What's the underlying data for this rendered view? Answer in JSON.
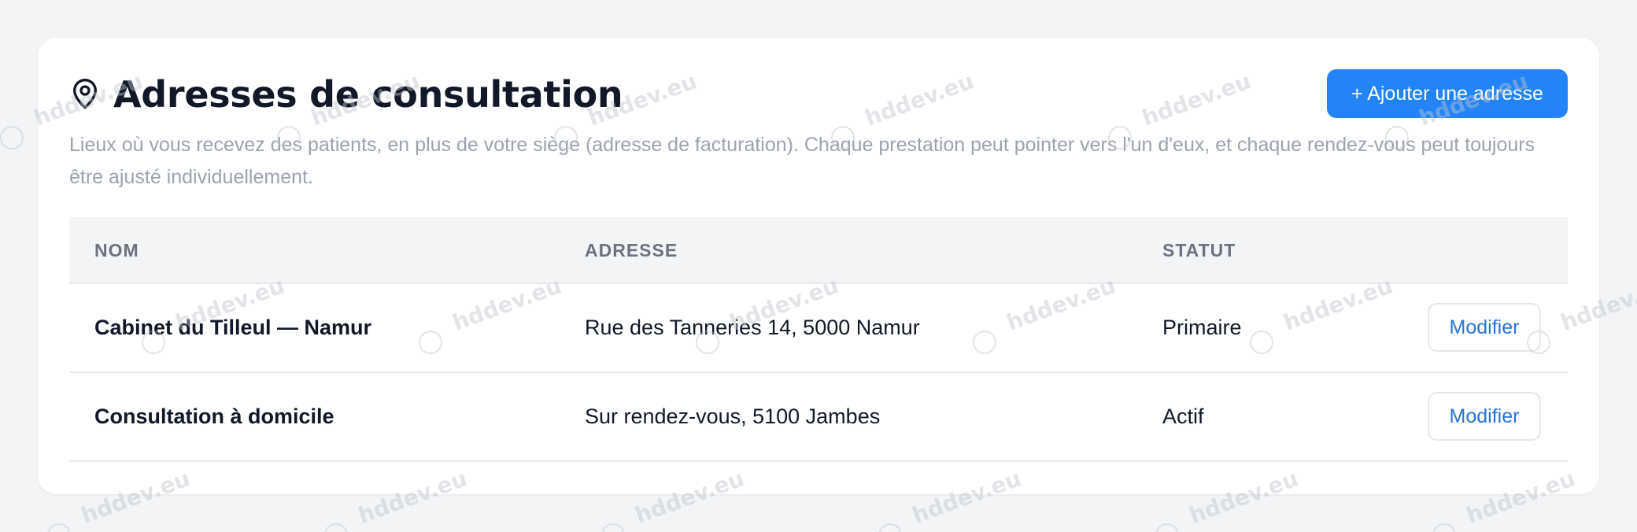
{
  "header": {
    "title": "Adresses de consultation",
    "add_button_label": "+ Ajouter une adresse",
    "description": "Lieux où vous recevez des patients, en plus de votre siège (adresse de facturation). Chaque prestation peut pointer vers l'un d'eux, et chaque rendez-vous peut toujours être ajusté individuellement.",
    "icon": "map-pin-icon"
  },
  "table": {
    "columns": [
      "NOM",
      "ADRESSE",
      "STATUT"
    ],
    "rows": [
      {
        "name": "Cabinet du Tilleul — Namur",
        "address": "Rue des Tanneries 14, 5000 Namur",
        "status": "Primaire",
        "action": "Modifier"
      },
      {
        "name": "Consultation à domicile",
        "address": "Sur rendez-vous, 5100 Jambes",
        "status": "Actif",
        "action": "Modifier"
      }
    ]
  },
  "watermark": "hddev.eu",
  "colors": {
    "accent": "#2384f7",
    "link": "#2474d6",
    "background": "#f3f4f6",
    "text": "#111827",
    "muted": "#9ca3af"
  }
}
